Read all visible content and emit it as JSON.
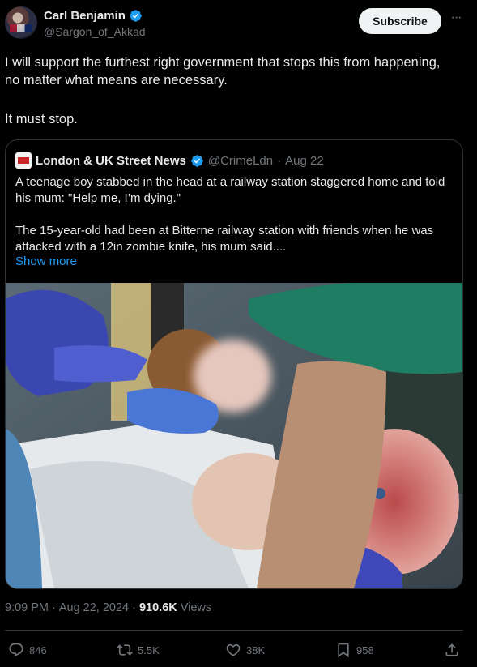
{
  "author": {
    "display_name": "Carl Benjamin",
    "handle": "@Sargon_of_Akkad",
    "verified": true
  },
  "subscribe_label": "Subscribe",
  "more_icon": "more-horizontal-icon",
  "tweet": {
    "line1": "I will support the furthest right government that stops this from happening, no matter what means are necessary.",
    "line2": "It must stop."
  },
  "quote": {
    "display_name": "London & UK Street News",
    "handle": "@CrimeLdn",
    "separator": "·",
    "date": "Aug 22",
    "para1": "A teenage boy stabbed in the head at a railway station staggered home and told his mum: \"Help me, I’m dying.\"",
    "para2": "The 15-year-old had been at Bitterne railway station with friends when he was attacked with a 12in zombie knife, his mum said....",
    "show_more": "Show more"
  },
  "meta": {
    "time": "9:09 PM",
    "dot1": "·",
    "date": "Aug 22, 2024",
    "dot2": "·",
    "views_count": "910.6K",
    "views_label": "Views"
  },
  "actions": {
    "replies": "846",
    "reposts": "5.5K",
    "likes": "38K",
    "bookmarks": "958"
  },
  "colors": {
    "background": "#000000",
    "text": "#e7e9ea",
    "muted": "#71767b",
    "link": "#1d9bf0",
    "verified": "#1d9bf0",
    "border": "#2f3336"
  }
}
